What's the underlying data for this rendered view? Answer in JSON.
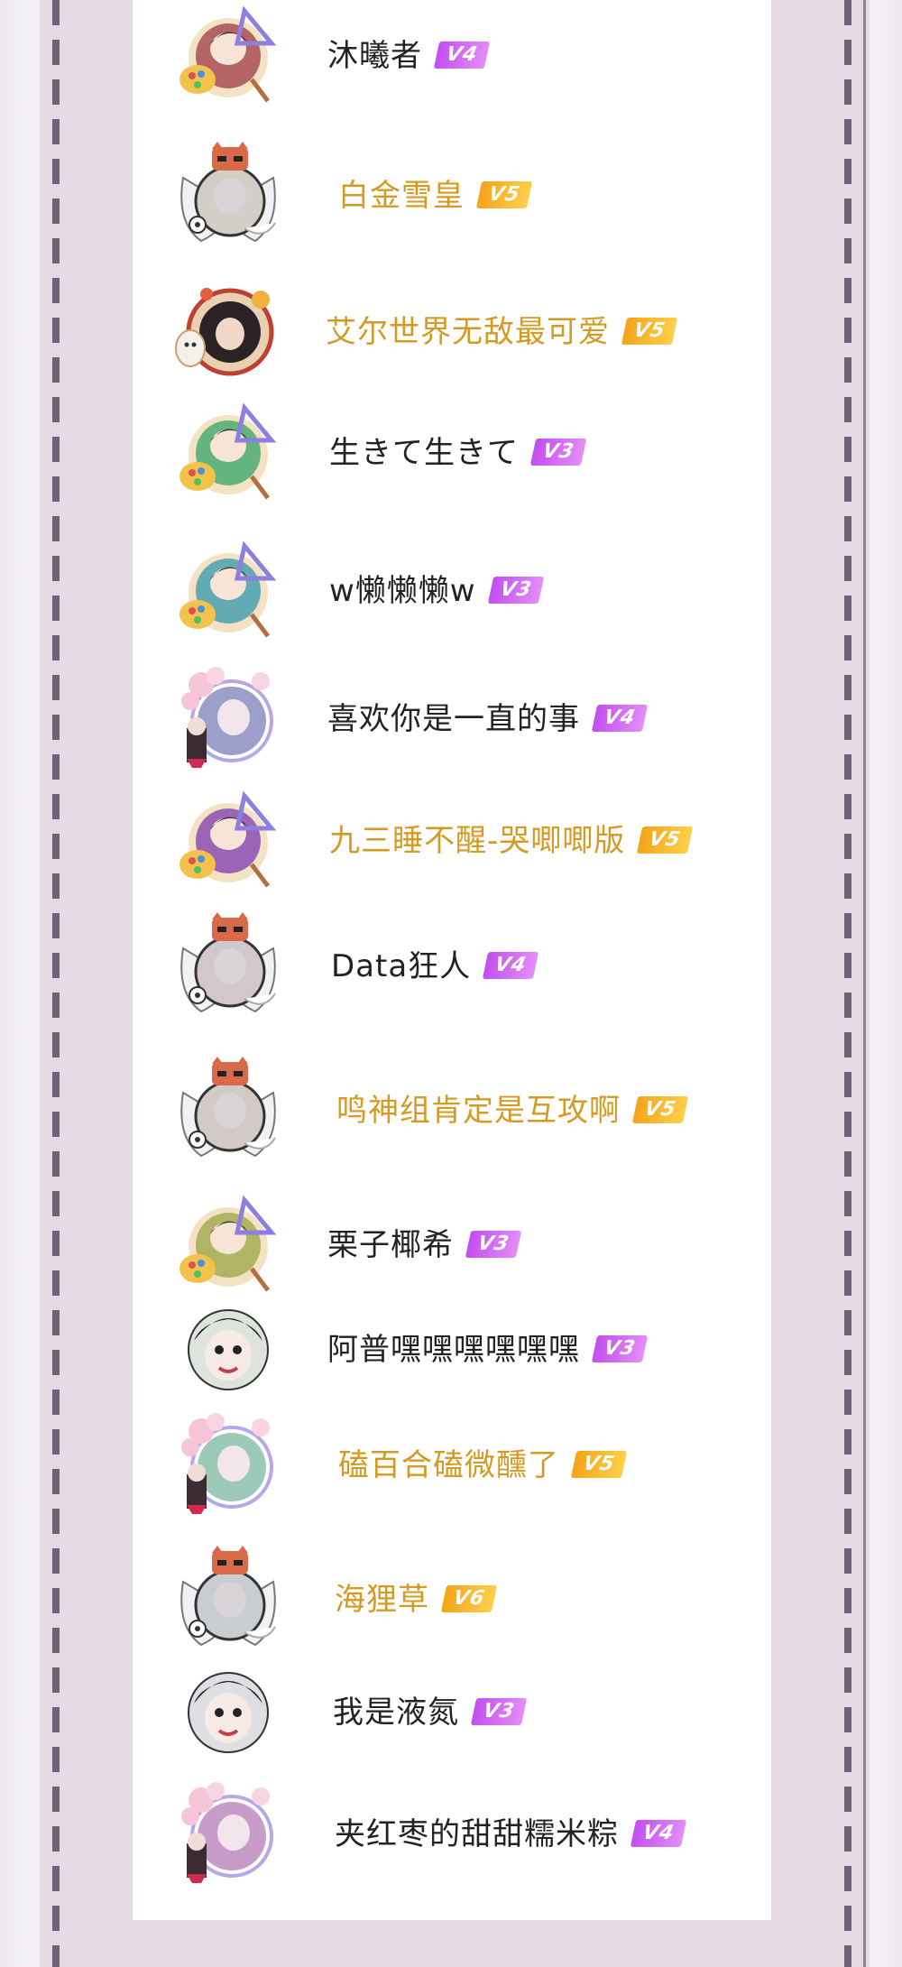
{
  "users": [
    {
      "name": "沐曦者",
      "level": "V4",
      "tier": "normal"
    },
    {
      "name": "白金雪皇",
      "level": "V5",
      "tier": "gold"
    },
    {
      "name": "艾尔世界无敌最可爱",
      "level": "V5",
      "tier": "gold"
    },
    {
      "name": "生きて生きて",
      "level": "V3",
      "tier": "normal"
    },
    {
      "name": "w懒懒懒w",
      "level": "V3",
      "tier": "normal"
    },
    {
      "name": "喜欢你是一直的事",
      "level": "V4",
      "tier": "normal"
    },
    {
      "name": "九三睡不醒-哭唧唧版",
      "level": "V5",
      "tier": "gold"
    },
    {
      "name": "Data狂人",
      "level": "V4",
      "tier": "normal"
    },
    {
      "name": "鸣神组肯定是互攻啊",
      "level": "V5",
      "tier": "gold"
    },
    {
      "name": "栗子椰希",
      "level": "V3",
      "tier": "normal"
    },
    {
      "name": "阿普嘿嘿嘿嘿嘿嘿",
      "level": "V3",
      "tier": "normal"
    },
    {
      "name": "磕百合磕微醺了",
      "level": "V5",
      "tier": "gold"
    },
    {
      "name": "海狸草",
      "level": "V6",
      "tier": "gold"
    },
    {
      "name": "我是液氮",
      "level": "V3",
      "tier": "normal"
    },
    {
      "name": "夹红枣的甜甜糯米粽",
      "level": "V4",
      "tier": "normal"
    }
  ],
  "colors": {
    "gold_name": "#d49a22",
    "normal_name": "#222222",
    "badge_purple": "#c24ef0",
    "badge_orange": "#f3a41a",
    "frame": "#e4dae4",
    "dash": "#6f6275"
  }
}
